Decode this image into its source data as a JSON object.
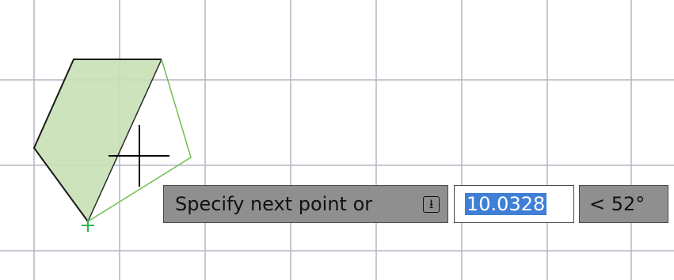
{
  "dynamic_input": {
    "prompt": "Specify next point or",
    "options_icon": "arrow-down-options-icon",
    "distance": "10.0328",
    "angle": "< 52°"
  },
  "colors": {
    "grid": "#b6b6c3",
    "polygon_fill": "#c6e0b4",
    "polygon_edge": "#1a1a1a",
    "rubber_band": "#6fbf4f",
    "start_marker": "#2bb24c",
    "crosshair": "#000000",
    "selection": "#3f7fd6"
  }
}
